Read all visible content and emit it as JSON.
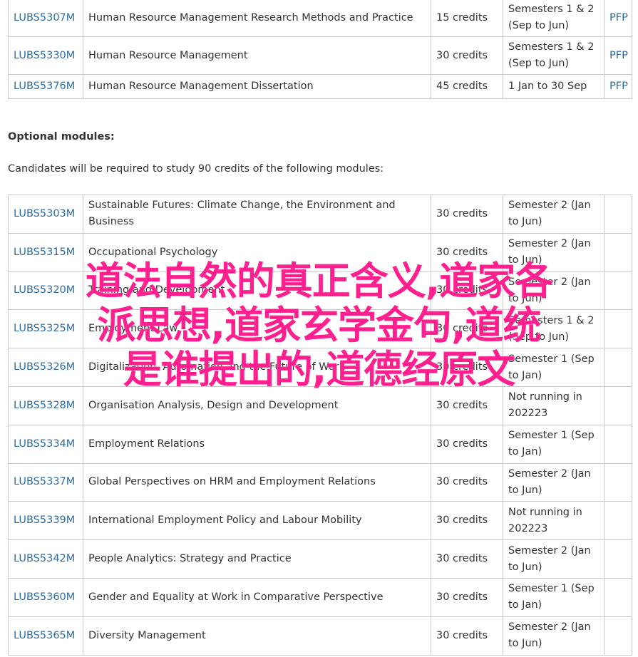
{
  "core_modules": [
    {
      "code": "LUBS5307M",
      "title": "Human Resource Management Research Methods and Practice",
      "credits": "15 credits",
      "semester": "Semesters 1 & 2 (Sep to Jun)",
      "pfp": "PFP"
    },
    {
      "code": "LUBS5330M",
      "title": "Human Resource Management",
      "credits": "30 credits",
      "semester": "Semesters 1 & 2 (Sep to Jun)",
      "pfp": "PFP"
    },
    {
      "code": "LUBS5376M",
      "title": "Human Resource Management Dissertation",
      "credits": "45 credits",
      "semester": "1 Jan to 30 Sep",
      "pfp": "PFP"
    }
  ],
  "optional": {
    "heading": "Optional modules:",
    "intro": "Candidates will be required to study 90 credits of the following modules:"
  },
  "optional_modules": [
    {
      "code": "LUBS5303M",
      "title": "Sustainable Futures: Climate Change, the Environment and Business",
      "credits": "30 credits",
      "semester": "Semester 2 (Jan to Jun)"
    },
    {
      "code": "LUBS5315M",
      "title": "Occupational Psychology",
      "credits": "30 credits",
      "semester": "Semester 2 (Jan to Jun)"
    },
    {
      "code": "LUBS5320M",
      "title": "Training and Development",
      "credits": "30 credits",
      "semester": "Semester 2 (Jan to Jun)"
    },
    {
      "code": "LUBS5325M",
      "title": "Employment Law",
      "credits": "30 credits",
      "semester": "Semesters 1 & 2 (Sep to Jun)"
    },
    {
      "code": "LUBS5326M",
      "title": "Digitalization, Automation and the Future of Work",
      "credits": "30 credits",
      "semester": "Semester 1 (Sep to Jan)"
    },
    {
      "code": "LUBS5328M",
      "title": "Organisation Analysis, Design and Development",
      "credits": "30 credits",
      "semester": "Not running in 202223"
    },
    {
      "code": "LUBS5334M",
      "title": "Employment Relations",
      "credits": "30 credits",
      "semester": "Semester 1 (Sep to Jan)"
    },
    {
      "code": "LUBS5337M",
      "title": "Global Perspectives on HRM and Employment Relations",
      "credits": "30 credits",
      "semester": "Semester 2 (Jan to Jun)"
    },
    {
      "code": "LUBS5339M",
      "title": "International Employment Policy and Labour Mobility",
      "credits": "30 credits",
      "semester": "Not running in 202223"
    },
    {
      "code": "LUBS5342M",
      "title": "People Analytics: Strategy and Practice",
      "credits": "30 credits",
      "semester": "Semester 2 (Jan to Jun)"
    },
    {
      "code": "LUBS5360M",
      "title": "Gender and Equality at Work in Comparative Perspective",
      "credits": "30 credits",
      "semester": "Semester 1 (Sep to Jan)"
    },
    {
      "code": "LUBS5365M",
      "title": "Diversity Management",
      "credits": "30 credits",
      "semester": "Semester 2 (Jan to Jun)"
    }
  ],
  "overlay": {
    "lines": [
      "道法自然的真正含义,道家各",
      "派思想,道家玄学金句,道统",
      "是谁提出的,道德经原文"
    ],
    "color": "#ff1f8e"
  },
  "colors": {
    "link": "#2e6da4",
    "border": "#c9c9c9",
    "text": "#333333"
  }
}
